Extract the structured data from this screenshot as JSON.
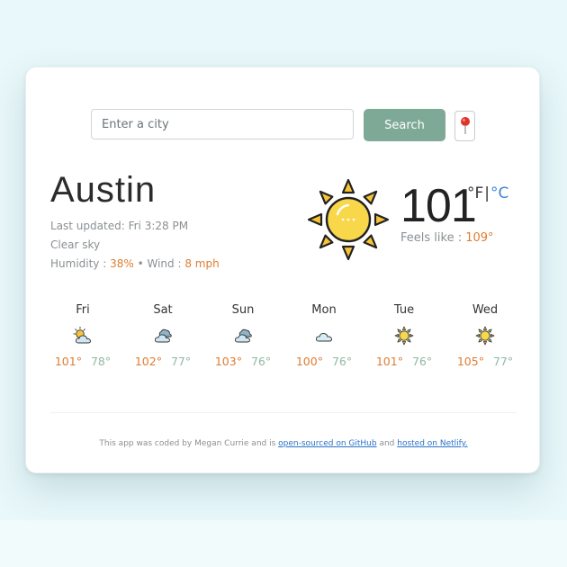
{
  "search": {
    "placeholder": "Enter a city",
    "value": "",
    "button_label": "Search",
    "location_icon": "map-pin-icon"
  },
  "current": {
    "city": "Austin",
    "last_updated_label": "Last updated: ",
    "last_updated": "Fri 3:28 PM",
    "description": "Clear sky",
    "humidity_label": "Humidity : ",
    "humidity": "38%",
    "separator": " • ",
    "wind_label": "Wind : ",
    "wind": "8 mph",
    "icon": "sun-icon",
    "temperature": "101",
    "unit_f": "°F",
    "unit_sep": "|",
    "unit_c": "°C",
    "feels_like_label": "Feels like : ",
    "feels_like": "109°"
  },
  "forecast": [
    {
      "day": "Fri",
      "icon": "partly-cloudy-icon",
      "high": "101°",
      "low": "78°"
    },
    {
      "day": "Sat",
      "icon": "cloudy-icon",
      "high": "102°",
      "low": "77°"
    },
    {
      "day": "Sun",
      "icon": "cloudy-icon",
      "high": "103°",
      "low": "76°"
    },
    {
      "day": "Mon",
      "icon": "cloud-icon",
      "high": "100°",
      "low": "76°"
    },
    {
      "day": "Tue",
      "icon": "sun-icon",
      "high": "101°",
      "low": "76°"
    },
    {
      "day": "Wed",
      "icon": "sun-icon",
      "high": "105°",
      "low": "77°"
    }
  ],
  "footer": {
    "text": "This app was coded by Megan Currie and is ",
    "link1": "open-sourced on GitHub",
    "middle": " and ",
    "link2": "hosted on Netlify."
  },
  "colors": {
    "accent_orange": "#e07c2f",
    "low_temp_green": "#8fb9a4",
    "search_button": "#7ea996",
    "link_blue": "#2a72c8"
  }
}
